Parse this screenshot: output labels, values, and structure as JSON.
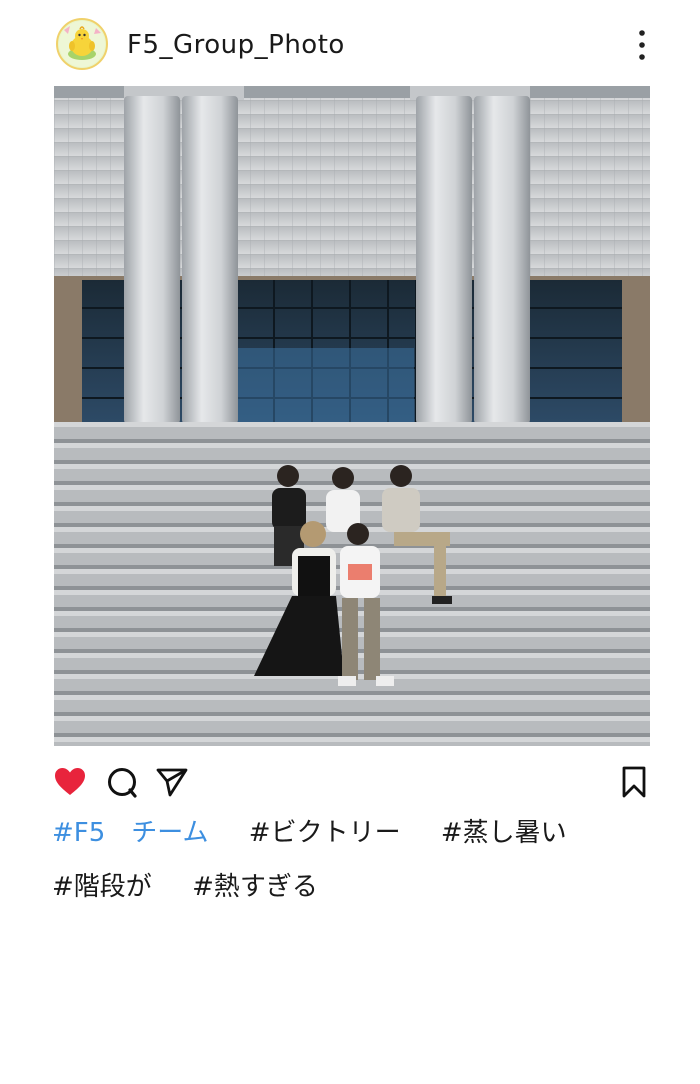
{
  "post": {
    "username": "F5_Group_Photo",
    "avatar_icon": "chick-icon",
    "photo_subject": "group-photo"
  },
  "actions": {
    "like_icon": "heart-icon",
    "comment_icon": "comment-icon",
    "share_icon": "send-icon",
    "save_icon": "bookmark-icon",
    "like_color": "#e8243c"
  },
  "hashtags": [
    {
      "text": "#F5　チーム",
      "color": "#3d8fe0"
    },
    {
      "text": "#ビクトリー",
      "color": "#1a1a1a"
    },
    {
      "text": "#蒸し暑い",
      "color": "#1a1a1a"
    },
    {
      "text": "#階段が",
      "color": "#1a1a1a"
    },
    {
      "text": "#熱すぎる",
      "color": "#1a1a1a"
    }
  ]
}
